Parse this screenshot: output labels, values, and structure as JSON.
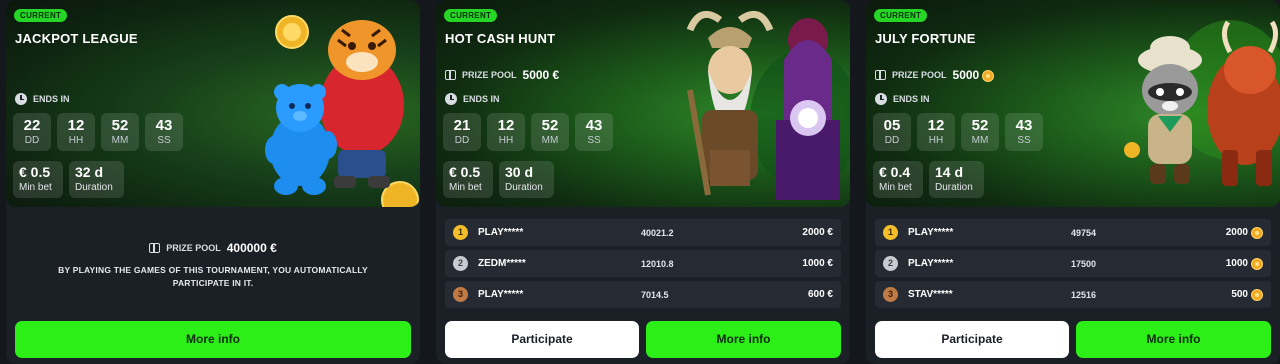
{
  "tournaments": [
    {
      "badge": "CURRENT",
      "title": "JACKPOT LEAGUE",
      "ends_label": "ENDS IN",
      "timer": [
        {
          "value": "22",
          "unit": "DD"
        },
        {
          "value": "12",
          "unit": "HH"
        },
        {
          "value": "52",
          "unit": "MM"
        },
        {
          "value": "43",
          "unit": "SS"
        }
      ],
      "min_bet": {
        "value": "€ 0.5",
        "label": "Min bet"
      },
      "duration": {
        "value": "32 d",
        "label": "Duration"
      },
      "prize_pool_label": "PRIZE POOL",
      "prize_pool_value": "400000 €",
      "info_text": "BY PLAYING THE GAMES OF THIS TOURNAMENT, YOU AUTOMATICALLY PARTICIPATE IN IT.",
      "more_info_label": "More info",
      "art_icons": [
        "tiger-mascot-icon",
        "blue-bear-icon",
        "gold-coin-icon"
      ]
    },
    {
      "badge": "CURRENT",
      "title": "HOT CASH HUNT",
      "prize_pool_label": "PRIZE POOL",
      "prize_pool_value": "5000 €",
      "ends_label": "ENDS IN",
      "timer": [
        {
          "value": "21",
          "unit": "DD"
        },
        {
          "value": "12",
          "unit": "HH"
        },
        {
          "value": "52",
          "unit": "MM"
        },
        {
          "value": "43",
          "unit": "SS"
        }
      ],
      "min_bet": {
        "value": "€ 0.5",
        "label": "Min bet"
      },
      "duration": {
        "value": "30 d",
        "label": "Duration"
      },
      "leaderboard": [
        {
          "rank": "1",
          "name": "PLAY*****",
          "score": "40021.2",
          "prize": "2000 €"
        },
        {
          "rank": "2",
          "name": "ZEDM*****",
          "score": "12010.8",
          "prize": "1000 €"
        },
        {
          "rank": "3",
          "name": "PLAY*****",
          "score": "7014.5",
          "prize": "600 €"
        }
      ],
      "participate_label": "Participate",
      "more_info_label": "More info",
      "art_icons": [
        "viking-warrior-icon",
        "fortune-teller-icon"
      ]
    },
    {
      "badge": "CURRENT",
      "title": "JULY FORTUNE",
      "prize_pool_label": "PRIZE POOL",
      "prize_pool_value": "5000",
      "prize_pool_currency_icon": "coin-icon",
      "ends_label": "ENDS IN",
      "timer": [
        {
          "value": "05",
          "unit": "DD"
        },
        {
          "value": "12",
          "unit": "HH"
        },
        {
          "value": "52",
          "unit": "MM"
        },
        {
          "value": "43",
          "unit": "SS"
        }
      ],
      "min_bet": {
        "value": "€ 0.4",
        "label": "Min bet"
      },
      "duration": {
        "value": "14 d",
        "label": "Duration"
      },
      "leaderboard": [
        {
          "rank": "1",
          "name": "PLAY*****",
          "score": "49754",
          "prize": "2000"
        },
        {
          "rank": "2",
          "name": "PLAY*****",
          "score": "17500",
          "prize": "1000"
        },
        {
          "rank": "3",
          "name": "STAV*****",
          "score": "12516",
          "prize": "500"
        }
      ],
      "participate_label": "Participate",
      "more_info_label": "More info",
      "art_icons": [
        "raccoon-explorer-icon",
        "fire-bison-icon"
      ]
    }
  ],
  "colors": {
    "accent_green": "#2bef17",
    "badge_green": "#26d626",
    "card_bg": "#1b1f26",
    "page_bg": "#14171c",
    "gold": "#f4be2a",
    "silver": "#c8ccd2",
    "bronze": "#c07a45"
  }
}
